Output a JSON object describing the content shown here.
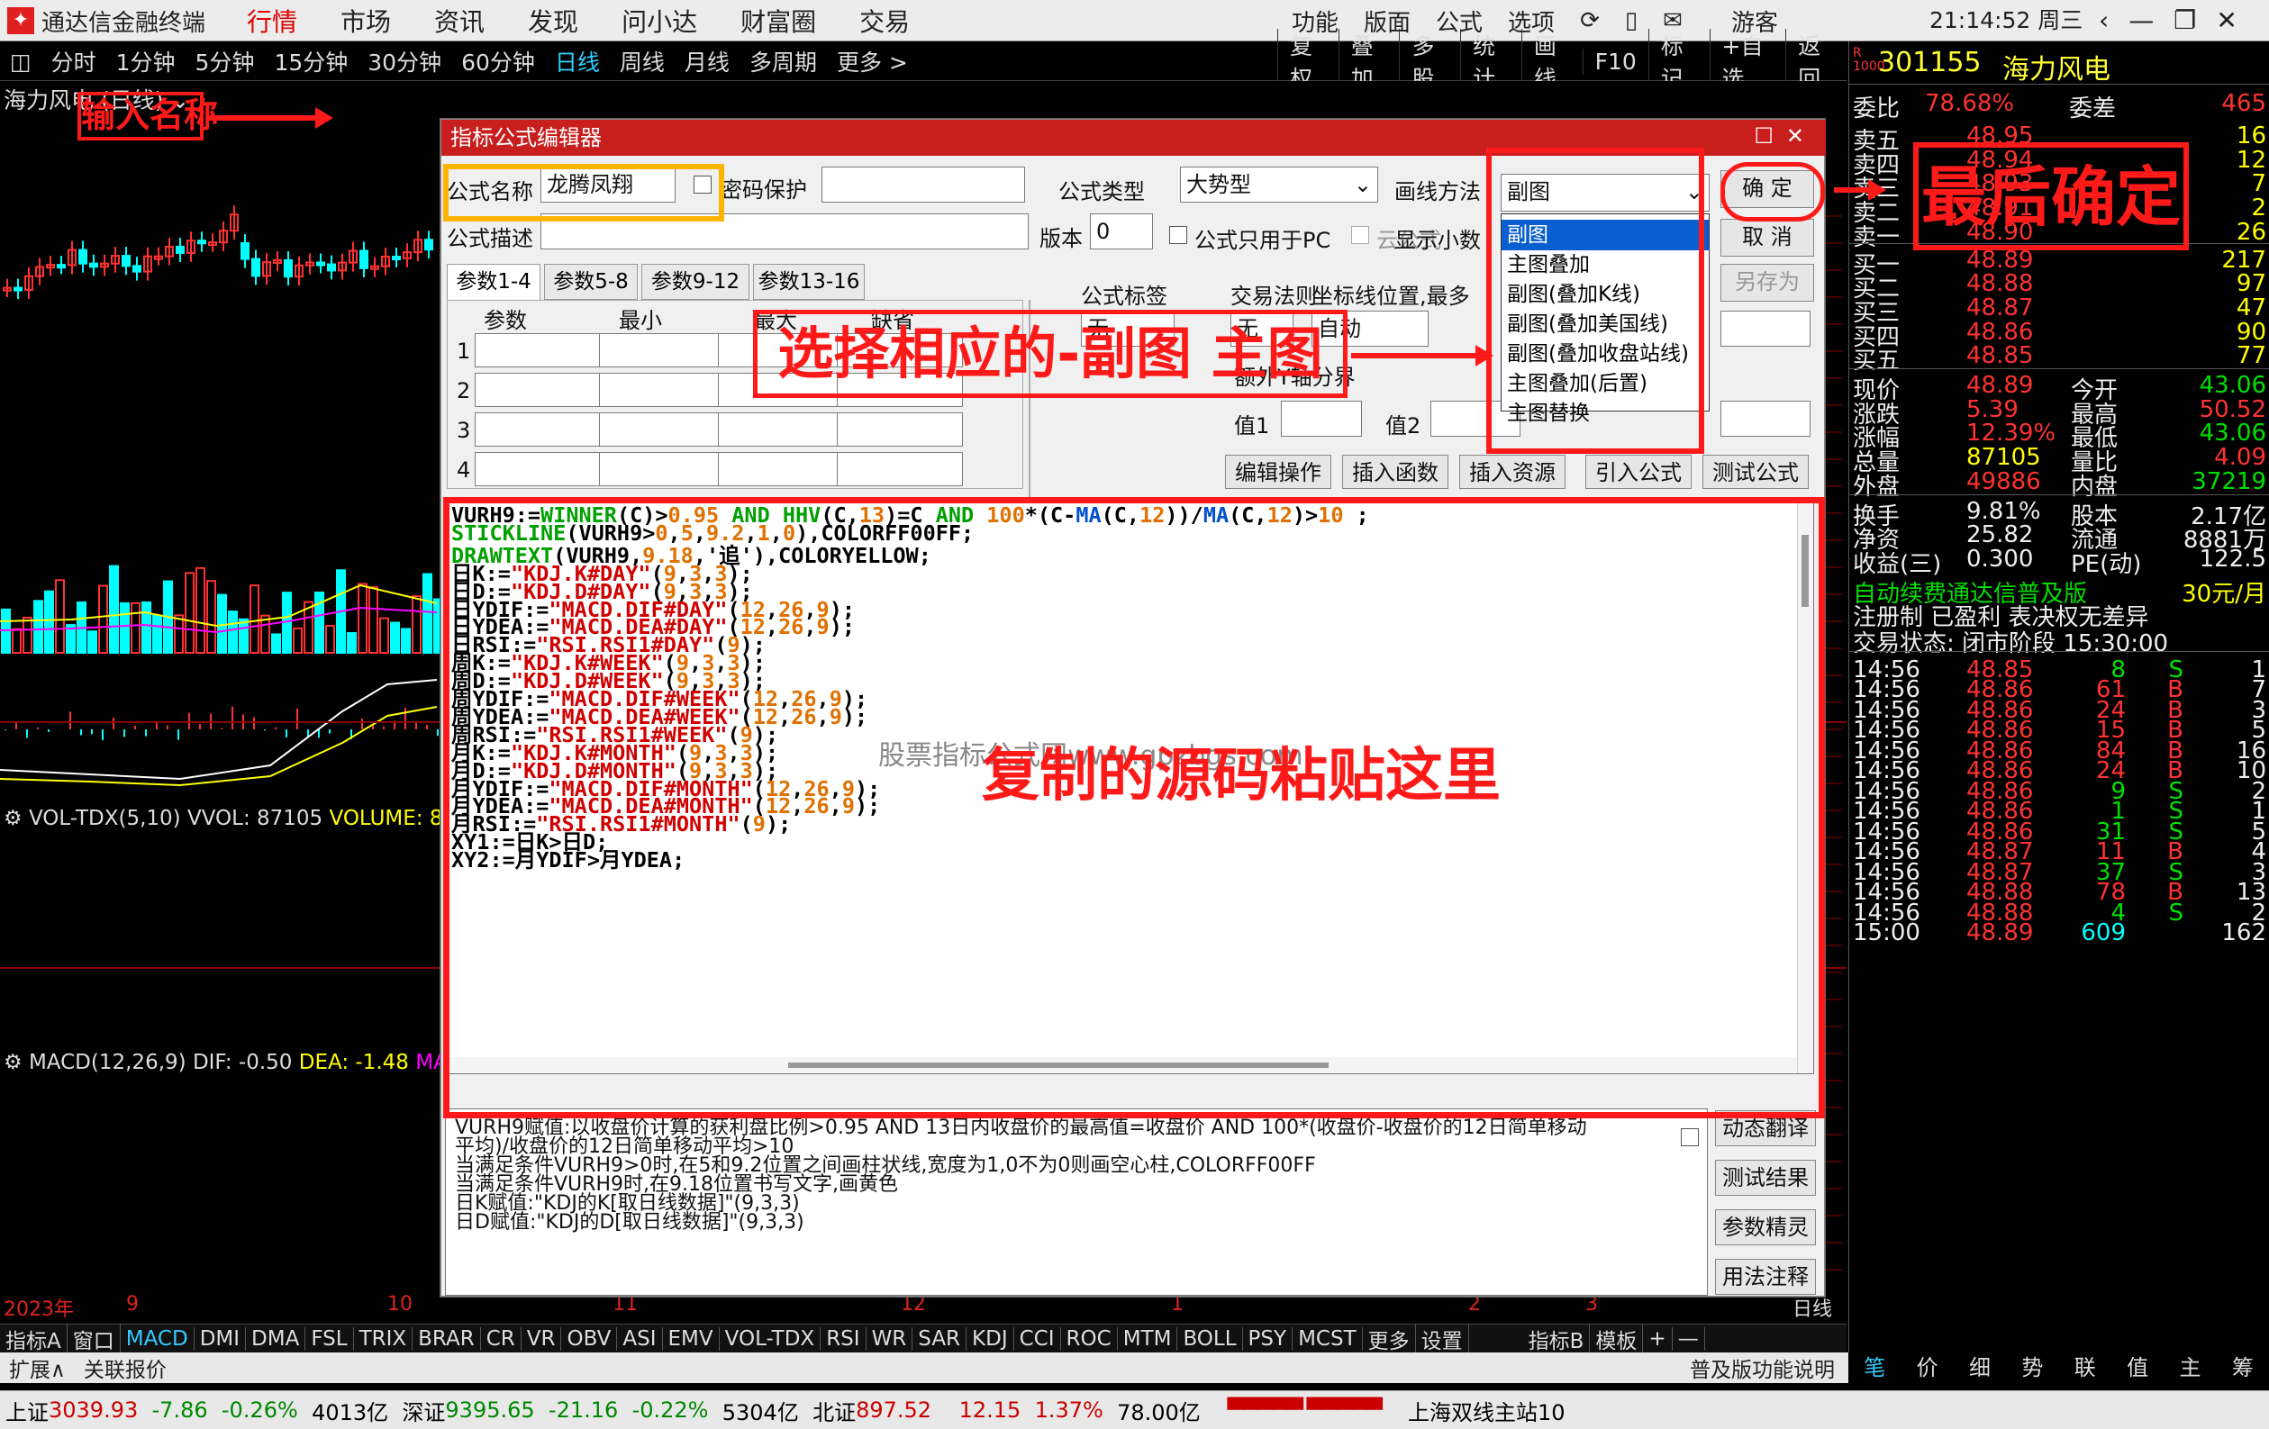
{
  "topbar": {
    "app_title": "通达信金融终端",
    "menus": [
      "行情",
      "市场",
      "资讯",
      "发现",
      "问小达",
      "财富圈",
      "交易"
    ],
    "right_menus": [
      "功能",
      "版面",
      "公式",
      "选项"
    ],
    "user": "游客",
    "clock": "21:14:52 周三"
  },
  "bar2": {
    "periods": [
      "分时",
      "1分钟",
      "5分钟",
      "15分钟",
      "30分钟",
      "60分钟",
      "日线",
      "周线",
      "月线",
      "多周期",
      "更多 >"
    ],
    "selected": "日线",
    "tools": [
      "复权",
      "叠加",
      "多股",
      "统计",
      "画线",
      "F10",
      "标记",
      "+自选",
      "返回"
    ]
  },
  "chart": {
    "title": "海力风电 (日线)",
    "vol_label": "VOL-TDX(5,10)",
    "vol_value": "VVOL: 87105",
    "vol_volume": "VOLUME: 8",
    "macd_label": "MACD(12,26,9)",
    "macd_dif": "DIF: -0.50",
    "macd_dea": "DEA: -1.48",
    "macd_ma": "MA",
    "date_labels": [
      "2023年",
      "9",
      "10",
      "11",
      "12",
      "1",
      "2",
      "3",
      "日线"
    ]
  },
  "quote": {
    "code": "301155",
    "name": "海力风电",
    "weibi_label": "委比",
    "weibi": "78.68%",
    "weicha_label": "委差",
    "weicha": "465",
    "sells": [
      {
        "label": "卖五",
        "price": "48.95",
        "vol": "16"
      },
      {
        "label": "卖四",
        "price": "48.94",
        "vol": "12"
      },
      {
        "label": "卖三",
        "price": "48.93",
        "vol": "7"
      },
      {
        "label": "卖二",
        "price": "48.91",
        "vol": "2"
      },
      {
        "label": "卖一",
        "price": "48.90",
        "vol": "26"
      }
    ],
    "buys": [
      {
        "label": "买一",
        "price": "48.89",
        "vol": "217"
      },
      {
        "label": "买二",
        "price": "48.88",
        "vol": "97"
      },
      {
        "label": "买三",
        "price": "48.87",
        "vol": "47"
      },
      {
        "label": "买四",
        "price": "48.86",
        "vol": "90"
      },
      {
        "label": "买五",
        "price": "48.85",
        "vol": "77"
      }
    ],
    "stats": [
      {
        "l1": "现价",
        "v1": "48.89",
        "l2": "今开",
        "v2": "43.06",
        "c1": "red",
        "c2": "green"
      },
      {
        "l1": "涨跌",
        "v1": "5.39",
        "l2": "最高",
        "v2": "50.52",
        "c1": "red",
        "c2": "red"
      },
      {
        "l1": "涨幅",
        "v1": "12.39%",
        "l2": "最低",
        "v2": "43.06",
        "c1": "red",
        "c2": "green"
      },
      {
        "l1": "总量",
        "v1": "87105",
        "l2": "量比",
        "v2": "4.09",
        "c1": "yellow",
        "c2": "red"
      },
      {
        "l1": "外盘",
        "v1": "49886",
        "l2": "内盘",
        "v2": "37219",
        "c1": "red",
        "c2": "green"
      }
    ],
    "stats2": [
      {
        "l1": "换手",
        "v1": "9.81%",
        "l2": "股本",
        "v2": "2.17亿"
      },
      {
        "l1": "净资",
        "v1": "25.82",
        "l2": "流通",
        "v2": "8881万"
      },
      {
        "l1": "收益(三)",
        "v1": "0.300",
        "l2": "PE(动)",
        "v2": "122.5"
      }
    ],
    "ad1": "自动续费通达信普及版",
    "ad1_price": "30元/月",
    "ad2": "注册制 已盈利 表决权无差异",
    "trade_status": "交易状态: 闭市阶段 15:30:00",
    "ticks": [
      {
        "t": "14:56",
        "p": "48.85",
        "v": "8",
        "s": "S",
        "n": "1"
      },
      {
        "t": "14:56",
        "p": "48.86",
        "v": "61",
        "s": "B",
        "n": "7"
      },
      {
        "t": "14:56",
        "p": "48.86",
        "v": "24",
        "s": "B",
        "n": "3"
      },
      {
        "t": "14:56",
        "p": "48.86",
        "v": "15",
        "s": "B",
        "n": "5"
      },
      {
        "t": "14:56",
        "p": "48.86",
        "v": "84",
        "s": "B",
        "n": "16"
      },
      {
        "t": "14:56",
        "p": "48.86",
        "v": "24",
        "s": "B",
        "n": "10"
      },
      {
        "t": "14:56",
        "p": "48.86",
        "v": "9",
        "s": "S",
        "n": "2"
      },
      {
        "t": "14:56",
        "p": "48.86",
        "v": "1",
        "s": "S",
        "n": "1"
      },
      {
        "t": "14:56",
        "p": "48.86",
        "v": "31",
        "s": "S",
        "n": "5"
      },
      {
        "t": "14:56",
        "p": "48.87",
        "v": "11",
        "s": "B",
        "n": "4"
      },
      {
        "t": "14:56",
        "p": "48.87",
        "v": "37",
        "s": "S",
        "n": "3"
      },
      {
        "t": "14:56",
        "p": "48.88",
        "v": "78",
        "s": "B",
        "n": "13"
      },
      {
        "t": "14:56",
        "p": "48.88",
        "v": "4",
        "s": "S",
        "n": "2"
      },
      {
        "t": "15:00",
        "p": "48.89",
        "v": "609",
        "s": "",
        "n": "162"
      }
    ],
    "bottom_tabs": [
      "笔",
      "价",
      "细",
      "势",
      "联",
      "值",
      "主",
      "筹"
    ]
  },
  "indicator_tabs": [
    "指标A",
    "窗口",
    "MACD",
    "DMI",
    "DMA",
    "FSL",
    "TRIX",
    "BRAR",
    "CR",
    "VR",
    "OBV",
    "ASI",
    "EMV",
    "VOL-TDX",
    "RSI",
    "WR",
    "SAR",
    "KDJ",
    "CCI",
    "ROC",
    "MTM",
    "BOLL",
    "PSY",
    "MCST",
    "更多",
    "设置",
    "指标B",
    "模板",
    "+",
    "—"
  ],
  "bar3": {
    "left": [
      "扩展∧",
      "关联报价"
    ],
    "right": "普及版功能说明"
  },
  "status": {
    "sh_label": "上证",
    "sh": "3039.93",
    "sh_chg": "-7.86",
    "sh_pct": "-0.26%",
    "sh_amt": "4013亿",
    "sz_label": "深证",
    "sz": "9395.65",
    "sz_chg": "-21.16",
    "sz_pct": "-0.22%",
    "sz_amt": "5304亿",
    "bz_label": "北证",
    "bz": "897.52",
    "bz_chg": "12.15",
    "bz_pct": "1.37%",
    "bz_amt": "78.00亿",
    "server": "上海双线主站10"
  },
  "dialog": {
    "title": "指标公式编辑器",
    "name_label": "公式名称",
    "name_value": "龙腾凤翔",
    "pwd_label": "密码保护",
    "type_label": "公式类型",
    "type_value": "大势型",
    "draw_label": "画线方法",
    "draw_value": "副图",
    "desc_label": "公式描述",
    "version_label": "版本",
    "version_value": "0",
    "pc_only": "公式只用于PC",
    "cloud": "云公式",
    "show_decimal": "显示小数",
    "ok": "确  定",
    "cancel": "取  消",
    "saveas": "另存为",
    "param_tabs": [
      "参数1-4",
      "参数5-8",
      "参数9-12",
      "参数13-16"
    ],
    "param_headers": [
      "参数",
      "最小",
      "最大",
      "缺省"
    ],
    "param_rows": [
      "1",
      "2",
      "3",
      "4"
    ],
    "tag_label": "公式标签",
    "tag_value": "无",
    "rule_label": "交易法则",
    "rule_value": "无",
    "axis_label": "坐标线位置,最多",
    "axis_value": "自动",
    "extra_label": "额外Y轴分界",
    "val1": "值1",
    "val2": "值2",
    "buttons": [
      "编辑操作",
      "插入函数",
      "插入资源",
      "引入公式",
      "测试公式"
    ],
    "draw_options": [
      "副图",
      "主图叠加",
      "副图(叠加K线)",
      "副图(叠加美国线)",
      "副图(叠加收盘站线)",
      "主图叠加(后置)",
      "主图替换"
    ],
    "code_lines": [
      [
        [
          "VURH9:=",
          "k"
        ],
        [
          "WINNER",
          "g"
        ],
        [
          "(C)>",
          "k"
        ],
        [
          "0.95",
          "o"
        ],
        [
          " AND ",
          "g"
        ],
        [
          "HHV",
          "g"
        ],
        [
          "(C,",
          "k"
        ],
        [
          "13",
          "o"
        ],
        [
          ")=C ",
          "k"
        ],
        [
          "AND",
          "g"
        ],
        [
          " ",
          "k"
        ],
        [
          "100",
          "o"
        ],
        [
          "*(C-",
          "k"
        ],
        [
          "MA",
          "b"
        ],
        [
          "(C,",
          "k"
        ],
        [
          "12",
          "o"
        ],
        [
          "))/",
          "k"
        ],
        [
          "MA",
          "b"
        ],
        [
          "(C,",
          "k"
        ],
        [
          "12",
          "o"
        ],
        [
          ")>",
          "k"
        ],
        [
          "10",
          "o"
        ],
        [
          " ;",
          "k"
        ]
      ],
      [
        [
          "STICKLINE",
          "g"
        ],
        [
          "(VURH9>",
          "k"
        ],
        [
          "0",
          "o"
        ],
        [
          ",",
          "k"
        ],
        [
          "5",
          "o"
        ],
        [
          ",",
          "k"
        ],
        [
          "9.2",
          "o"
        ],
        [
          ",",
          "k"
        ],
        [
          "1",
          "o"
        ],
        [
          ",",
          "k"
        ],
        [
          "0",
          "o"
        ],
        [
          "),COLORFF00FF;",
          "k"
        ]
      ],
      [
        [
          "DRAWTEXT",
          "g"
        ],
        [
          "(VURH9,",
          "k"
        ],
        [
          "9.18",
          "o"
        ],
        [
          ",'追'),COLORYELLOW;",
          "k"
        ]
      ],
      [
        [
          "日K:=",
          "k"
        ],
        [
          "\"KDJ.K#DAY\"",
          "r"
        ],
        [
          "(",
          "k"
        ],
        [
          "9",
          "o"
        ],
        [
          ",",
          "k"
        ],
        [
          "3",
          "o"
        ],
        [
          ",",
          "k"
        ],
        [
          "3",
          "o"
        ],
        [
          ");",
          "k"
        ]
      ],
      [
        [
          "日D:=",
          "k"
        ],
        [
          "\"KDJ.D#DAY\"",
          "r"
        ],
        [
          "(",
          "k"
        ],
        [
          "9",
          "o"
        ],
        [
          ",",
          "k"
        ],
        [
          "3",
          "o"
        ],
        [
          ",",
          "k"
        ],
        [
          "3",
          "o"
        ],
        [
          ");",
          "k"
        ]
      ],
      [
        [
          "日YDIF:=",
          "k"
        ],
        [
          "\"MACD.DIF#DAY\"",
          "r"
        ],
        [
          "(",
          "k"
        ],
        [
          "12",
          "o"
        ],
        [
          ",",
          "k"
        ],
        [
          "26",
          "o"
        ],
        [
          ",",
          "k"
        ],
        [
          "9",
          "o"
        ],
        [
          ");",
          "k"
        ]
      ],
      [
        [
          "日YDEA:=",
          "k"
        ],
        [
          "\"MACD.DEA#DAY\"",
          "r"
        ],
        [
          "(",
          "k"
        ],
        [
          "12",
          "o"
        ],
        [
          ",",
          "k"
        ],
        [
          "26",
          "o"
        ],
        [
          ",",
          "k"
        ],
        [
          "9",
          "o"
        ],
        [
          ");",
          "k"
        ]
      ],
      [
        [
          "日RSI:=",
          "k"
        ],
        [
          "\"RSI.RSI1#DAY\"",
          "r"
        ],
        [
          "(",
          "k"
        ],
        [
          "9",
          "o"
        ],
        [
          ");",
          "k"
        ]
      ],
      [
        [
          "周K:=",
          "k"
        ],
        [
          "\"KDJ.K#WEEK\"",
          "r"
        ],
        [
          "(",
          "k"
        ],
        [
          "9",
          "o"
        ],
        [
          ",",
          "k"
        ],
        [
          "3",
          "o"
        ],
        [
          ",",
          "k"
        ],
        [
          "3",
          "o"
        ],
        [
          ");",
          "k"
        ]
      ],
      [
        [
          "周D:=",
          "k"
        ],
        [
          "\"KDJ.D#WEEK\"",
          "r"
        ],
        [
          "(",
          "k"
        ],
        [
          "9",
          "o"
        ],
        [
          ",",
          "k"
        ],
        [
          "3",
          "o"
        ],
        [
          ",",
          "k"
        ],
        [
          "3",
          "o"
        ],
        [
          ");",
          "k"
        ]
      ],
      [
        [
          "周YDIF:=",
          "k"
        ],
        [
          "\"MACD.DIF#WEEK\"",
          "r"
        ],
        [
          "(",
          "k"
        ],
        [
          "12",
          "o"
        ],
        [
          ",",
          "k"
        ],
        [
          "26",
          "o"
        ],
        [
          ",",
          "k"
        ],
        [
          "9",
          "o"
        ],
        [
          ");",
          "k"
        ]
      ],
      [
        [
          "周YDEA:=",
          "k"
        ],
        [
          "\"MACD.DEA#WEEK\"",
          "r"
        ],
        [
          "(",
          "k"
        ],
        [
          "12",
          "o"
        ],
        [
          ",",
          "k"
        ],
        [
          "26",
          "o"
        ],
        [
          ",",
          "k"
        ],
        [
          "9",
          "o"
        ],
        [
          ");",
          "k"
        ]
      ],
      [
        [
          "周RSI:=",
          "k"
        ],
        [
          "\"RSI.RSI1#WEEK\"",
          "r"
        ],
        [
          "(",
          "k"
        ],
        [
          "9",
          "o"
        ],
        [
          ");",
          "k"
        ]
      ],
      [
        [
          "月K:=",
          "k"
        ],
        [
          "\"KDJ.K#MONTH\"",
          "r"
        ],
        [
          "(",
          "k"
        ],
        [
          "9",
          "o"
        ],
        [
          ",",
          "k"
        ],
        [
          "3",
          "o"
        ],
        [
          ",",
          "k"
        ],
        [
          "3",
          "o"
        ],
        [
          ");",
          "k"
        ]
      ],
      [
        [
          "月D:=",
          "k"
        ],
        [
          "\"KDJ.D#MONTH\"",
          "r"
        ],
        [
          "(",
          "k"
        ],
        [
          "9",
          "o"
        ],
        [
          ",",
          "k"
        ],
        [
          "3",
          "o"
        ],
        [
          ",",
          "k"
        ],
        [
          "3",
          "o"
        ],
        [
          ");",
          "k"
        ]
      ],
      [
        [
          "月YDIF:=",
          "k"
        ],
        [
          "\"MACD.DIF#MONTH\"",
          "r"
        ],
        [
          "(",
          "k"
        ],
        [
          "12",
          "o"
        ],
        [
          ",",
          "k"
        ],
        [
          "26",
          "o"
        ],
        [
          ",",
          "k"
        ],
        [
          "9",
          "o"
        ],
        [
          ");",
          "k"
        ]
      ],
      [
        [
          "月YDEA:=",
          "k"
        ],
        [
          "\"MACD.DEA#MONTH\"",
          "r"
        ],
        [
          "(",
          "k"
        ],
        [
          "12",
          "o"
        ],
        [
          ",",
          "k"
        ],
        [
          "26",
          "o"
        ],
        [
          ",",
          "k"
        ],
        [
          "9",
          "o"
        ],
        [
          ");",
          "k"
        ]
      ],
      [
        [
          "月RSI:=",
          "k"
        ],
        [
          "\"RSI.RSI1#MONTH\"",
          "r"
        ],
        [
          "(",
          "k"
        ],
        [
          "9",
          "o"
        ],
        [
          ");",
          "k"
        ]
      ],
      [
        [
          "XY1:=日K>日D;",
          "k"
        ]
      ],
      [
        [
          "XY2:=月YDIF>月YDEA;",
          "k"
        ]
      ]
    ],
    "desc_lines": [
      "VURH9赋值:以收盘价计算的获利盘比例>0.95 AND 13日内收盘价的最高值=收盘价 AND 100*(收盘价-收盘价的12日简单移动",
      "平均)/收盘价的12日简单移动平均>10",
      "当满足条件VURH9>0时,在5和9.2位置之间画柱状线,宽度为1,0不为0则画空心柱,COLORFF00FF",
      "当满足条件VURH9时,在9.18位置书写文字,画黄色",
      "日K赋值:\"KDJ的K[取日线数据]\"(9,3,3)",
      "日D赋值:\"KDJ的D[取日线数据]\"(9,3,3)"
    ],
    "side_buttons": [
      "动态翻译",
      "测试结果",
      "参数精灵",
      "用法注释"
    ],
    "watermark": "股票指标公式网www.gpzbgs.com"
  },
  "annotations": {
    "input_name": "输入名称",
    "select_chart": "选择相应的-副图 主图",
    "confirm": "最后确定",
    "paste_here": "复制的源码粘贴这里"
  },
  "colors": {
    "code_green": "#00a000",
    "code_orange": "#e07000",
    "code_red": "#d00000",
    "code_blue": "#0050d0",
    "accent_red": "#ff1a1a",
    "title_red": "#c81e1e"
  }
}
